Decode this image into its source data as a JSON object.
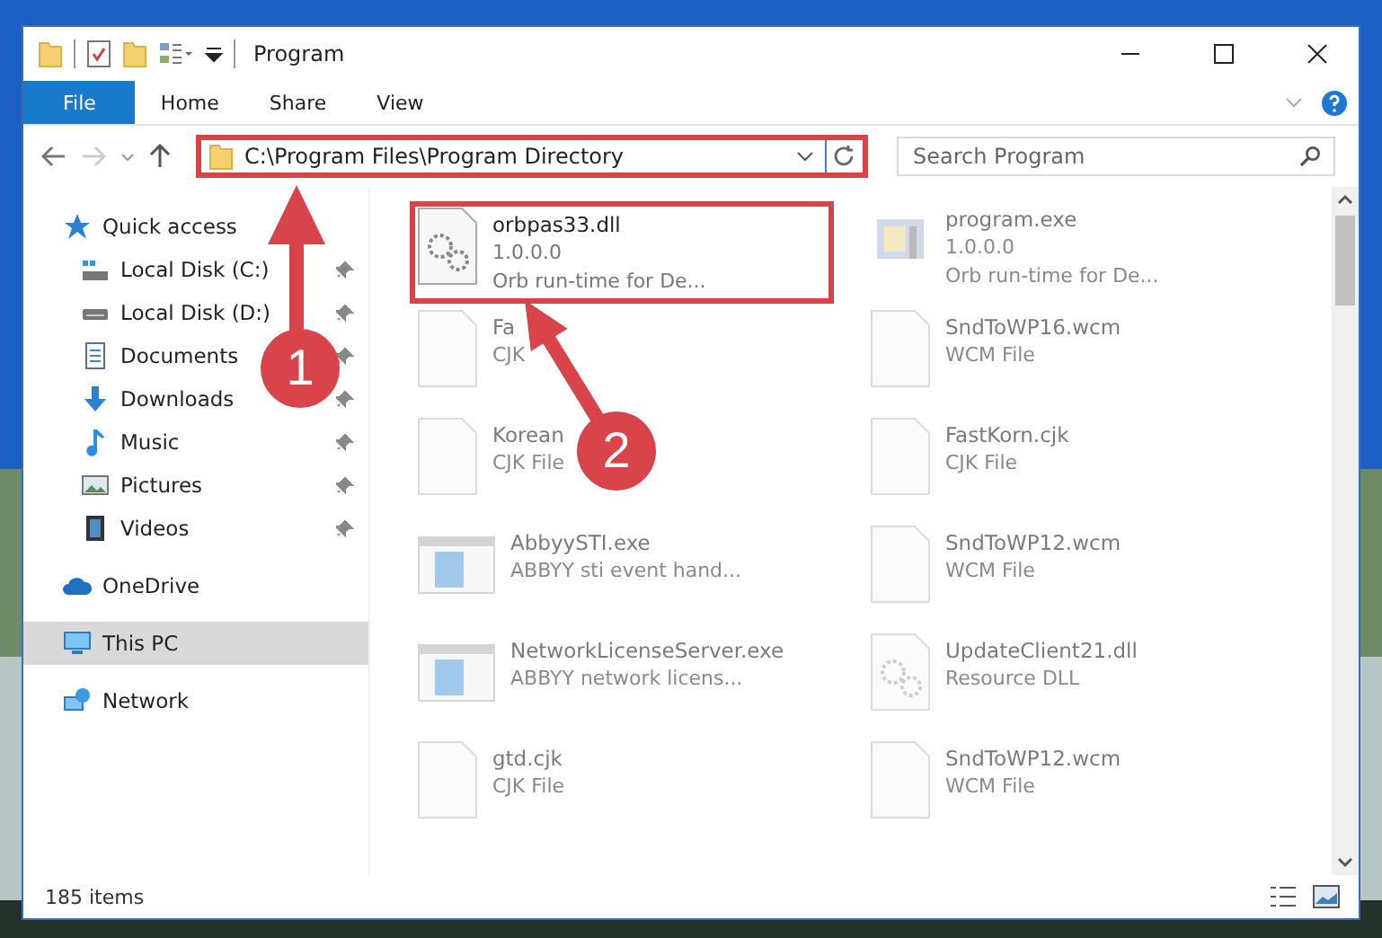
{
  "window": {
    "title": "Program"
  },
  "ribbon": {
    "tabs": [
      {
        "label": "File",
        "selected": true
      },
      {
        "label": "Home",
        "selected": false
      },
      {
        "label": "Share",
        "selected": false
      },
      {
        "label": "View",
        "selected": false
      }
    ]
  },
  "address": {
    "path": "C:\\Program Files\\Program Directory",
    "highlighted": true
  },
  "search": {
    "placeholder": "Search Program"
  },
  "sidebar": {
    "items": [
      {
        "label": "Quick access",
        "selected": false,
        "children": [
          {
            "label": "Local Disk (C:)",
            "pinned": true
          },
          {
            "label": "Local Disk (D:)",
            "pinned": true
          },
          {
            "label": "Documents",
            "pinned": true
          },
          {
            "label": "Downloads",
            "pinned": true
          },
          {
            "label": "Music",
            "pinned": true
          },
          {
            "label": "Pictures",
            "pinned": true
          },
          {
            "label": "Videos",
            "pinned": true
          }
        ]
      },
      {
        "label": "OneDrive",
        "selected": false
      },
      {
        "label": "This PC",
        "selected": true
      },
      {
        "label": "Network",
        "selected": false
      }
    ]
  },
  "files": [
    {
      "name": "orbpas33.dll",
      "details": [
        "1.0.0.0",
        "Orb run-time for De..."
      ],
      "kind": "library",
      "faded": false,
      "highlighted": true
    },
    {
      "name": "program.exe",
      "details": [
        "1.0.0.0",
        "Orb run-time for De..."
      ],
      "kind": "installer",
      "faded": true,
      "highlighted": false
    },
    {
      "name": "Fa",
      "details": [
        "CJK"
      ],
      "kind": "document",
      "faded": true,
      "highlighted": false
    },
    {
      "name": "SndToWP16.wcm",
      "details": [
        "WCM File"
      ],
      "kind": "document",
      "faded": true,
      "highlighted": false
    },
    {
      "name": "Korean",
      "details": [
        "CJK File"
      ],
      "kind": "document",
      "faded": true,
      "highlighted": false
    },
    {
      "name": "FastKorn.cjk",
      "details": [
        "CJK File"
      ],
      "kind": "document",
      "faded": true,
      "highlighted": false
    },
    {
      "name": "AbbyySTI.exe",
      "details": [
        "ABBYY sti event hand..."
      ],
      "kind": "application",
      "faded": true,
      "highlighted": false
    },
    {
      "name": "SndToWP12.wcm",
      "details": [
        "WCM File"
      ],
      "kind": "document",
      "faded": true,
      "highlighted": false
    },
    {
      "name": "NetworkLicenseServer.exe",
      "details": [
        "ABBYY network licens..."
      ],
      "kind": "application",
      "faded": true,
      "highlighted": false
    },
    {
      "name": "UpdateClient21.dll",
      "details": [
        "Resource DLL"
      ],
      "kind": "library",
      "faded": true,
      "highlighted": false
    },
    {
      "name": "gtd.cjk",
      "details": [
        "CJK File"
      ],
      "kind": "document",
      "faded": true,
      "highlighted": false
    },
    {
      "name": "SndToWP12.wcm",
      "details": [
        "WCM File"
      ],
      "kind": "document",
      "faded": true,
      "highlighted": false
    }
  ],
  "annotations": [
    {
      "number": "1"
    },
    {
      "number": "2"
    }
  ],
  "status_bar": {
    "count": "185 items"
  }
}
